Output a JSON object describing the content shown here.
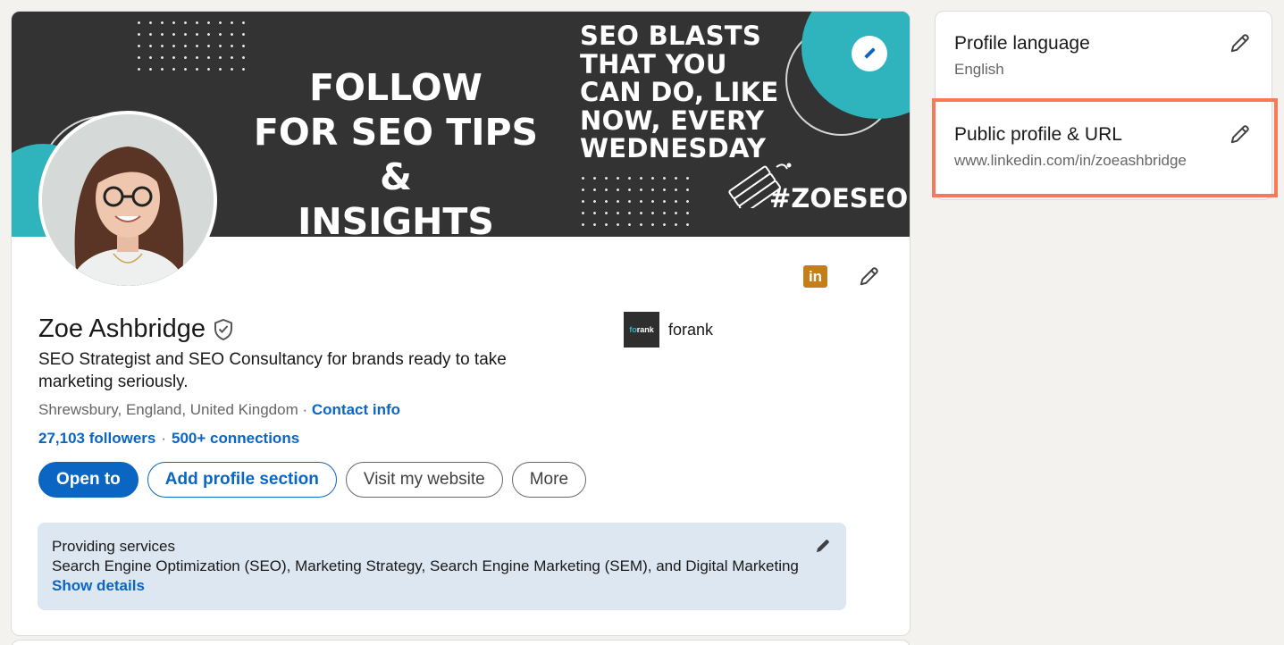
{
  "banner": {
    "left_text": [
      "FOLLOW",
      "FOR SEO TIPS &",
      "INSIGHTS"
    ],
    "right_text": [
      "SEO BLASTS",
      "THAT YOU",
      "CAN DO, LIKE",
      "NOW, EVERY",
      "WEDNESDAY"
    ],
    "hashtag": "#ZOESEO"
  },
  "profile": {
    "name": "Zoe Ashbridge",
    "headline": "SEO Strategist and SEO Consultancy for brands ready to take marketing seriously.",
    "location": "Shrewsbury, England, United Kingdom",
    "location_sep": " · ",
    "contact_info": "Contact info",
    "followers": "27,103 followers",
    "connections": "500+ connections",
    "linkedin_badge": "in"
  },
  "company": {
    "logo_text_accent": "fo",
    "logo_text_rest": "rank",
    "name": "forank"
  },
  "actions": {
    "open_to": "Open to",
    "add_section": "Add profile section",
    "visit_website": "Visit my website",
    "more": "More"
  },
  "services": {
    "title": "Providing services",
    "list": "Search Engine Optimization (SEO), Marketing Strategy, Search Engine Marketing (SEM), and Digital Marketing",
    "link": "Show details"
  },
  "sidebar": {
    "language_title": "Profile language",
    "language_value": "English",
    "url_title": "Public profile & URL",
    "url_value": "www.linkedin.com/in/zoeashbridge"
  },
  "colors": {
    "linkedin_blue": "#0a66c2",
    "banner_bg": "#333333",
    "teal": "#2fb3bd",
    "highlight": "#f47a5a",
    "services_bg": "#dde7f1"
  }
}
